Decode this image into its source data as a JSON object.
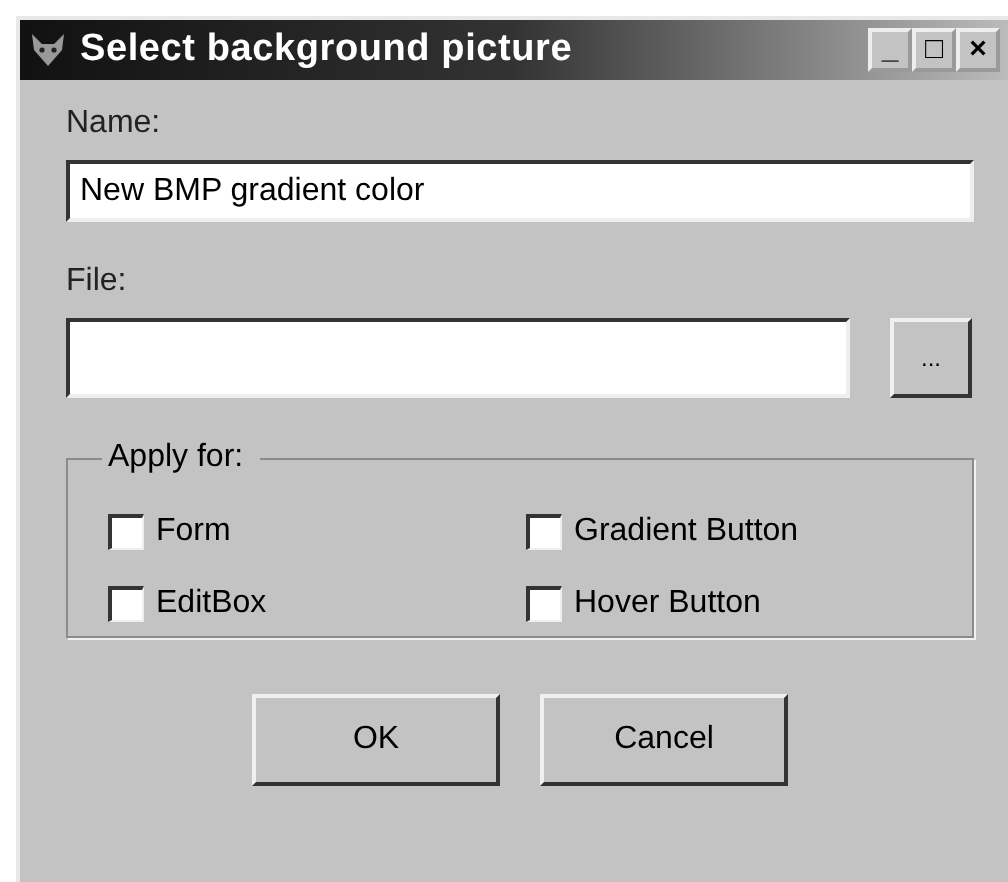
{
  "window": {
    "title": "Select background picture",
    "controls": [
      "_",
      "□",
      "×"
    ]
  },
  "name_field": {
    "label": "Name:",
    "value": "New BMP gradient color"
  },
  "file_field": {
    "label": "File:",
    "browse": "..."
  },
  "apply_for": {
    "label": "Apply for:",
    "options": [
      {
        "label": "Form",
        "checked": false
      },
      {
        "label": "Gradient Button",
        "checked": false
      },
      {
        "label": "EditBox",
        "checked": false
      },
      {
        "label": "Hover Button",
        "checked": false
      }
    ]
  },
  "buttons": [
    "OK",
    "Cancel"
  ]
}
